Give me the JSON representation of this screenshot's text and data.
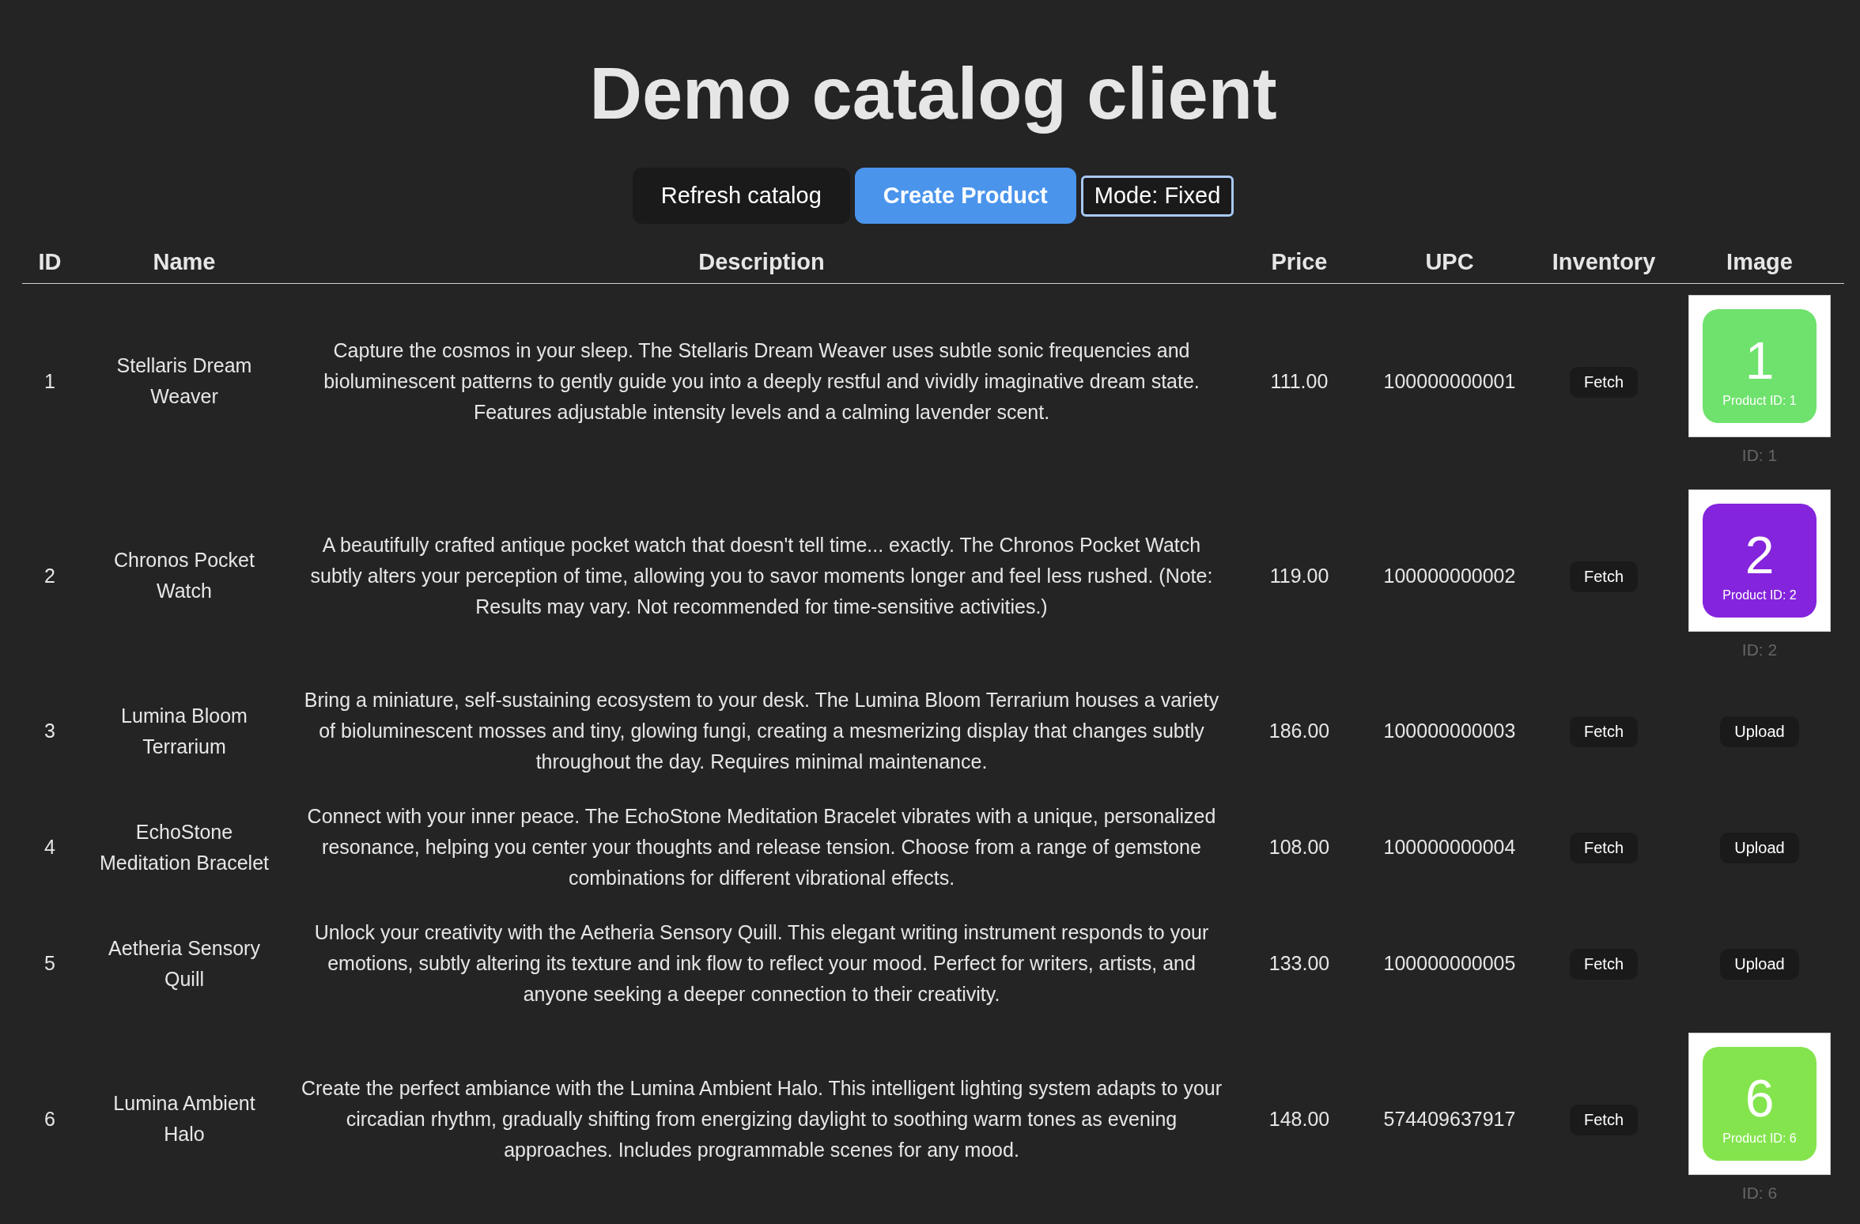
{
  "title": "Demo catalog client",
  "toolbar": [
    {
      "label": "Refresh catalog",
      "kind": "default"
    },
    {
      "label": "Create Product",
      "kind": "primary"
    },
    {
      "label": "Mode: Fixed",
      "kind": "mode"
    }
  ],
  "table": {
    "columns": [
      "ID",
      "Name",
      "Description",
      "Price",
      "UPC",
      "Inventory",
      "Image"
    ],
    "rows": [
      {
        "id": "1",
        "name": "Stellaris Dream Weaver",
        "description": "Capture the cosmos in your sleep. The Stellaris Dream Weaver uses subtle sonic frequencies and bioluminescent patterns to gently guide you into a deeply restful and vividly imaginative dream state. Features adjustable intensity levels and a calming lavender scent.",
        "price": "111.00",
        "upc": "100000000001",
        "inventory": "Fetch",
        "image": {
          "kind": "tile",
          "number": "1",
          "caption": "Product ID: 1",
          "color": "#6ee26c",
          "id_label": "ID: 1"
        }
      },
      {
        "id": "2",
        "name": "Chronos Pocket Watch",
        "description": "A beautifully crafted antique pocket watch that doesn't tell time... exactly. The Chronos Pocket Watch subtly alters your perception of time, allowing you to savor moments longer and feel less rushed. (Note: Results may vary. Not recommended for time-sensitive activities.)",
        "price": "119.00",
        "upc": "100000000002",
        "inventory": "Fetch",
        "image": {
          "kind": "tile",
          "number": "2",
          "caption": "Product ID: 2",
          "color": "#8424dc",
          "id_label": "ID: 2"
        }
      },
      {
        "id": "3",
        "name": "Lumina Bloom Terrarium",
        "description": "Bring a miniature, self-sustaining ecosystem to your desk. The Lumina Bloom Terrarium houses a variety of bioluminescent mosses and tiny, glowing fungi, creating a mesmerizing display that changes subtly throughout the day. Requires minimal maintenance.",
        "price": "186.00",
        "upc": "100000000003",
        "inventory": "Fetch",
        "image": {
          "kind": "upload",
          "label": "Upload"
        }
      },
      {
        "id": "4",
        "name": "EchoStone Meditation Bracelet",
        "description": "Connect with your inner peace. The EchoStone Meditation Bracelet vibrates with a unique, personalized resonance, helping you center your thoughts and release tension. Choose from a range of gemstone combinations for different vibrational effects.",
        "price": "108.00",
        "upc": "100000000004",
        "inventory": "Fetch",
        "image": {
          "kind": "upload",
          "label": "Upload"
        }
      },
      {
        "id": "5",
        "name": "Aetheria Sensory Quill",
        "description": "Unlock your creativity with the Aetheria Sensory Quill. This elegant writing instrument responds to your emotions, subtly altering its texture and ink flow to reflect your mood. Perfect for writers, artists, and anyone seeking a deeper connection to their creativity.",
        "price": "133.00",
        "upc": "100000000005",
        "inventory": "Fetch",
        "image": {
          "kind": "upload",
          "label": "Upload"
        }
      },
      {
        "id": "6",
        "name": "Lumina Ambient Halo",
        "description": "Create the perfect ambiance with the Lumina Ambient Halo. This intelligent lighting system adapts to your circadian rhythm, gradually shifting from energizing daylight to soothing warm tones as evening approaches. Includes programmable scenes for any mood.",
        "price": "148.00",
        "upc": "574409637917",
        "inventory": "Fetch",
        "image": {
          "kind": "tile",
          "number": "6",
          "caption": "Product ID: 6",
          "color": "#84e44e",
          "id_label": "ID: 6"
        }
      }
    ]
  }
}
